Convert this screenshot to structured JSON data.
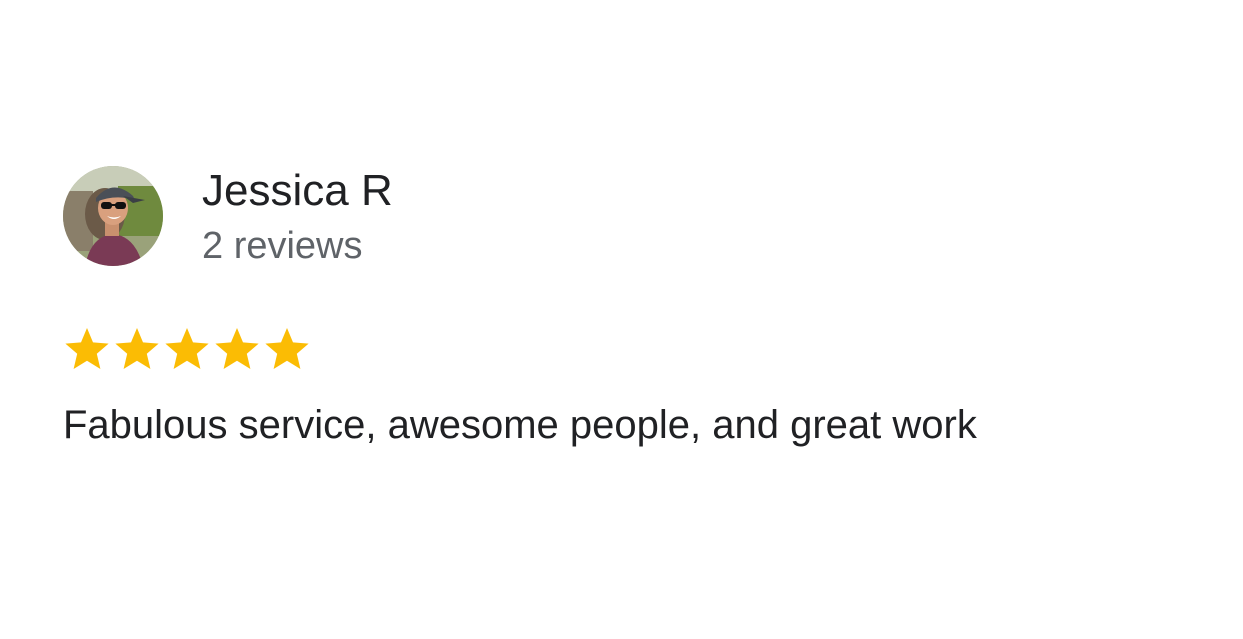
{
  "review": {
    "reviewer_name": "Jessica R",
    "review_count": "2 reviews",
    "rating": 5,
    "max_rating": 5,
    "text": "Fabulous service, awesome people, and great work"
  },
  "colors": {
    "star": "#fbbc04",
    "name_text": "#202124",
    "secondary_text": "#5f6368"
  },
  "icons": {
    "avatar": "user-photo-avatar",
    "star": "star-icon"
  }
}
